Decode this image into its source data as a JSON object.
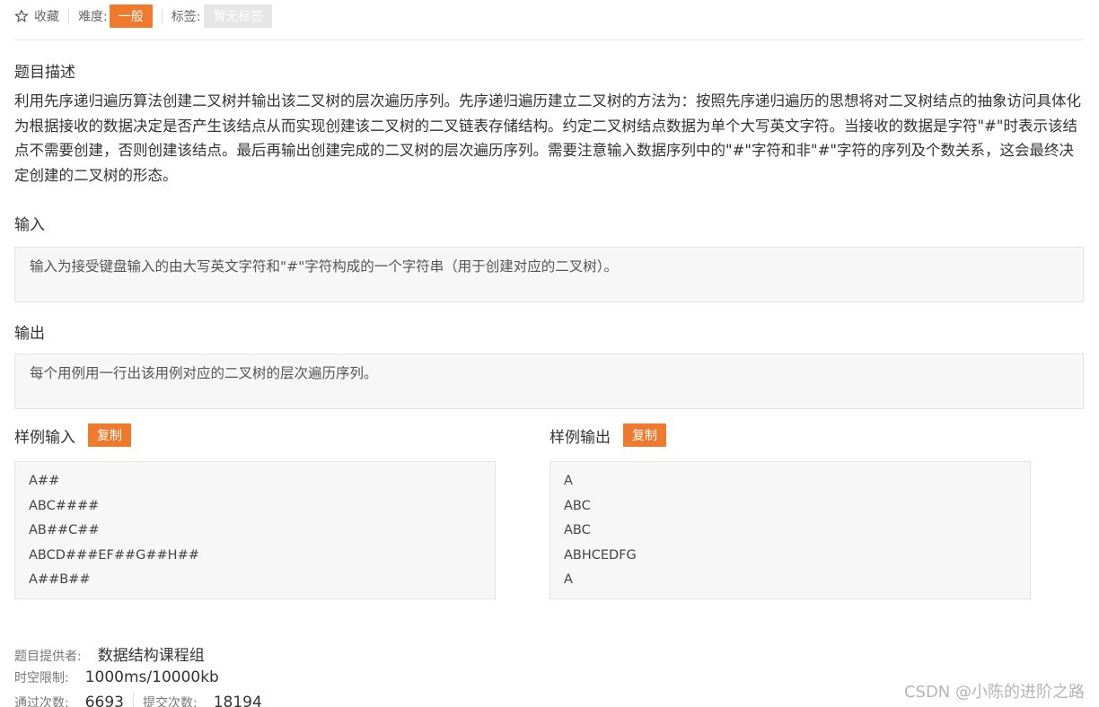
{
  "topbar": {
    "favorite_label": "收藏",
    "difficulty_label": "难度:",
    "difficulty_value": "一般",
    "tags_label": "标签:",
    "tags_value": "暂无标签"
  },
  "description": {
    "heading": "题目描述",
    "text": "利用先序递归遍历算法创建二叉树并输出该二叉树的层次遍历序列。先序递归遍历建立二叉树的方法为：按照先序递归遍历的思想将对二叉树结点的抽象访问具体化为根据接收的数据决定是否产生该结点从而实现创建该二叉树的二叉链表存储结构。约定二叉树结点数据为单个大写英文字符。当接收的数据是字符\"#\"时表示该结点不需要创建，否则创建该结点。最后再输出创建完成的二叉树的层次遍历序列。需要注意输入数据序列中的\"#\"字符和非\"#\"字符的序列及个数关系，这会最终决定创建的二叉树的形态。"
  },
  "input": {
    "heading": "输入",
    "text": "输入为接受键盘输入的由大写英文字符和\"#\"字符构成的一个字符串（用于创建对应的二叉树）。"
  },
  "output": {
    "heading": "输出",
    "text": "每个用例用一行出该用例对应的二叉树的层次遍历序列。"
  },
  "sample_input": {
    "heading": "样例输入",
    "copy_label": "复制",
    "lines": [
      "A##",
      "ABC####",
      "AB##C##",
      "ABCD###EF##G##H##",
      "A##B##"
    ]
  },
  "sample_output": {
    "heading": "样例输出",
    "copy_label": "复制",
    "lines": [
      "A",
      "ABC",
      "ABC",
      "ABHCEDFG",
      "A"
    ]
  },
  "meta": {
    "provider_label": "题目提供者:",
    "provider_value": "数据结构课程组",
    "limit_label": "时空限制:",
    "limit_value": "1000ms/10000kb",
    "passed_label": "通过次数:",
    "passed_value": "6693",
    "submitted_label": "提交次数:",
    "submitted_value": "18194"
  },
  "watermark": "CSDN @小陈的进阶之路",
  "colors": {
    "accent": "#ef7a2e",
    "tag_bg": "#e6e6e6",
    "box_bg": "#f7f7f7"
  },
  "icons": {
    "favorite": "star-outline-icon"
  }
}
